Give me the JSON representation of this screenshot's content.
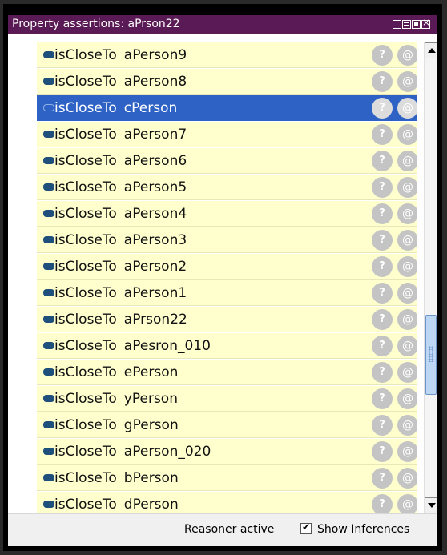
{
  "panel": {
    "title": "Property assertions: aPrson22",
    "window_buttons": [
      "layout-icon",
      "view-icon",
      "maximize-icon",
      "close-icon"
    ]
  },
  "assertions": [
    {
      "property": "isCloseTo",
      "object": "aPerson9",
      "selected": false
    },
    {
      "property": "isCloseTo",
      "object": "aPerson8",
      "selected": false
    },
    {
      "property": "isCloseTo",
      "object": "cPerson",
      "selected": true
    },
    {
      "property": "isCloseTo",
      "object": "aPerson7",
      "selected": false
    },
    {
      "property": "isCloseTo",
      "object": "aPerson6",
      "selected": false
    },
    {
      "property": "isCloseTo",
      "object": "aPerson5",
      "selected": false
    },
    {
      "property": "isCloseTo",
      "object": "aPerson4",
      "selected": false
    },
    {
      "property": "isCloseTo",
      "object": "aPerson3",
      "selected": false
    },
    {
      "property": "isCloseTo",
      "object": "aPerson2",
      "selected": false
    },
    {
      "property": "isCloseTo",
      "object": "aPerson1",
      "selected": false
    },
    {
      "property": "isCloseTo",
      "object": "aPrson22",
      "selected": false
    },
    {
      "property": "isCloseTo",
      "object": "aPesron_010",
      "selected": false
    },
    {
      "property": "isCloseTo",
      "object": "ePerson",
      "selected": false
    },
    {
      "property": "isCloseTo",
      "object": "yPerson",
      "selected": false
    },
    {
      "property": "isCloseTo",
      "object": "gPerson",
      "selected": false
    },
    {
      "property": "isCloseTo",
      "object": "aPerson_020",
      "selected": false
    },
    {
      "property": "isCloseTo",
      "object": "bPerson",
      "selected": false
    },
    {
      "property": "isCloseTo",
      "object": "dPerson",
      "selected": false
    }
  ],
  "row_buttons": {
    "explain": "?",
    "annotate": "@"
  },
  "footer": {
    "reasoner_status": "Reasoner active",
    "show_inferences_label": "Show Inferences",
    "show_inferences_checked": true
  },
  "colors": {
    "title_bar": "#5a1a55",
    "row_background": "#ffffce",
    "selected_row": "#2e62c5",
    "property_icon": "#1f4f7b"
  }
}
